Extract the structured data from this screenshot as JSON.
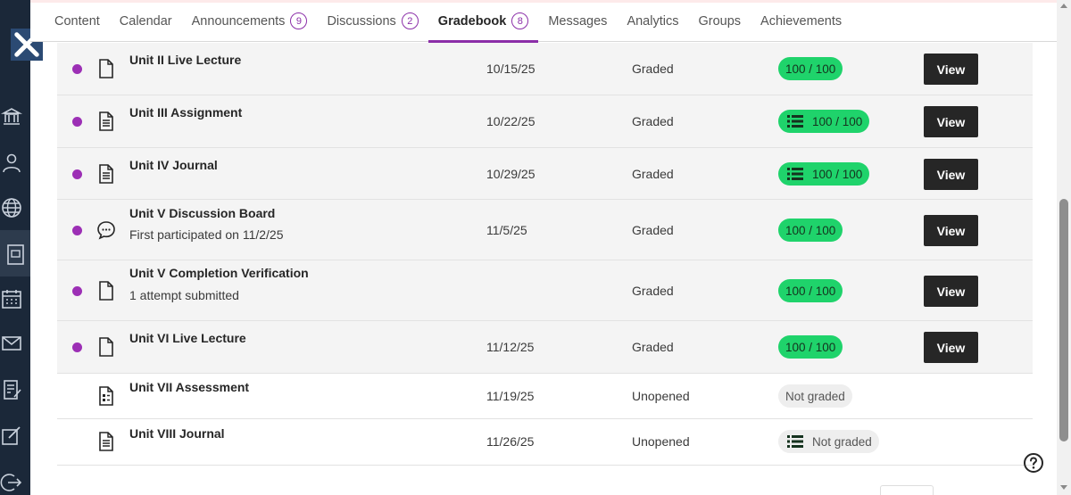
{
  "tabs": [
    {
      "label": "Content"
    },
    {
      "label": "Calendar"
    },
    {
      "label": "Announcements",
      "count": "9"
    },
    {
      "label": "Discussions",
      "count": "2"
    },
    {
      "label": "Gradebook",
      "count": "8",
      "active": true
    },
    {
      "label": "Messages"
    },
    {
      "label": "Analytics"
    },
    {
      "label": "Groups"
    },
    {
      "label": "Achievements"
    }
  ],
  "sidebar_icons": [
    "institution-icon",
    "profile-icon",
    "globe-icon",
    "courses-icon",
    "calendar-icon",
    "messages-icon",
    "grades-icon",
    "edit-icon",
    "sign-out-icon"
  ],
  "colors": {
    "accent": "#8b2ea8",
    "graded_pill": "#1fd36b",
    "sidebar": "#1b2839",
    "new_dot": "#9c2fb5"
  },
  "items": [
    {
      "title": "Unit II Live Lecture",
      "subtitle": "",
      "date": "10/15/25",
      "status": "Graded",
      "grade": "100 / 100",
      "rubric": false,
      "graded": true,
      "new": true,
      "icon": "document-icon",
      "view": "View"
    },
    {
      "title": "Unit III Assignment",
      "subtitle": "",
      "date": "10/22/25",
      "status": "Graded",
      "grade": "100 / 100",
      "rubric": true,
      "graded": true,
      "new": true,
      "icon": "assignment-icon",
      "view": "View"
    },
    {
      "title": "Unit IV Journal",
      "subtitle": "",
      "date": "10/29/25",
      "status": "Graded",
      "grade": "100 / 100",
      "rubric": true,
      "graded": true,
      "new": true,
      "icon": "assignment-icon",
      "view": "View"
    },
    {
      "title": "Unit V Discussion Board",
      "subtitle": "First participated on 11/2/25",
      "date": "11/5/25",
      "status": "Graded",
      "grade": "100 / 100",
      "rubric": false,
      "graded": true,
      "new": true,
      "icon": "discussion-icon",
      "view": "View"
    },
    {
      "title": "Unit V Completion Verification",
      "subtitle": "1 attempt submitted",
      "date": "",
      "status": "Graded",
      "grade": "100 / 100",
      "rubric": false,
      "graded": true,
      "new": true,
      "icon": "document-icon",
      "view": "View"
    },
    {
      "title": "Unit VI Live Lecture",
      "subtitle": "",
      "date": "11/12/25",
      "status": "Graded",
      "grade": "100 / 100",
      "rubric": false,
      "graded": true,
      "new": true,
      "icon": "document-icon",
      "view": "View"
    },
    {
      "title": "Unit VII Assessment",
      "subtitle": "",
      "date": "11/19/25",
      "status": "Unopened",
      "grade": "Not graded",
      "rubric": false,
      "graded": false,
      "new": false,
      "icon": "test-icon",
      "view": ""
    },
    {
      "title": "Unit VIII Journal",
      "subtitle": "",
      "date": "11/26/25",
      "status": "Unopened",
      "grade": "Not graded",
      "rubric": true,
      "graded": false,
      "new": false,
      "icon": "assignment-icon",
      "view": ""
    }
  ]
}
